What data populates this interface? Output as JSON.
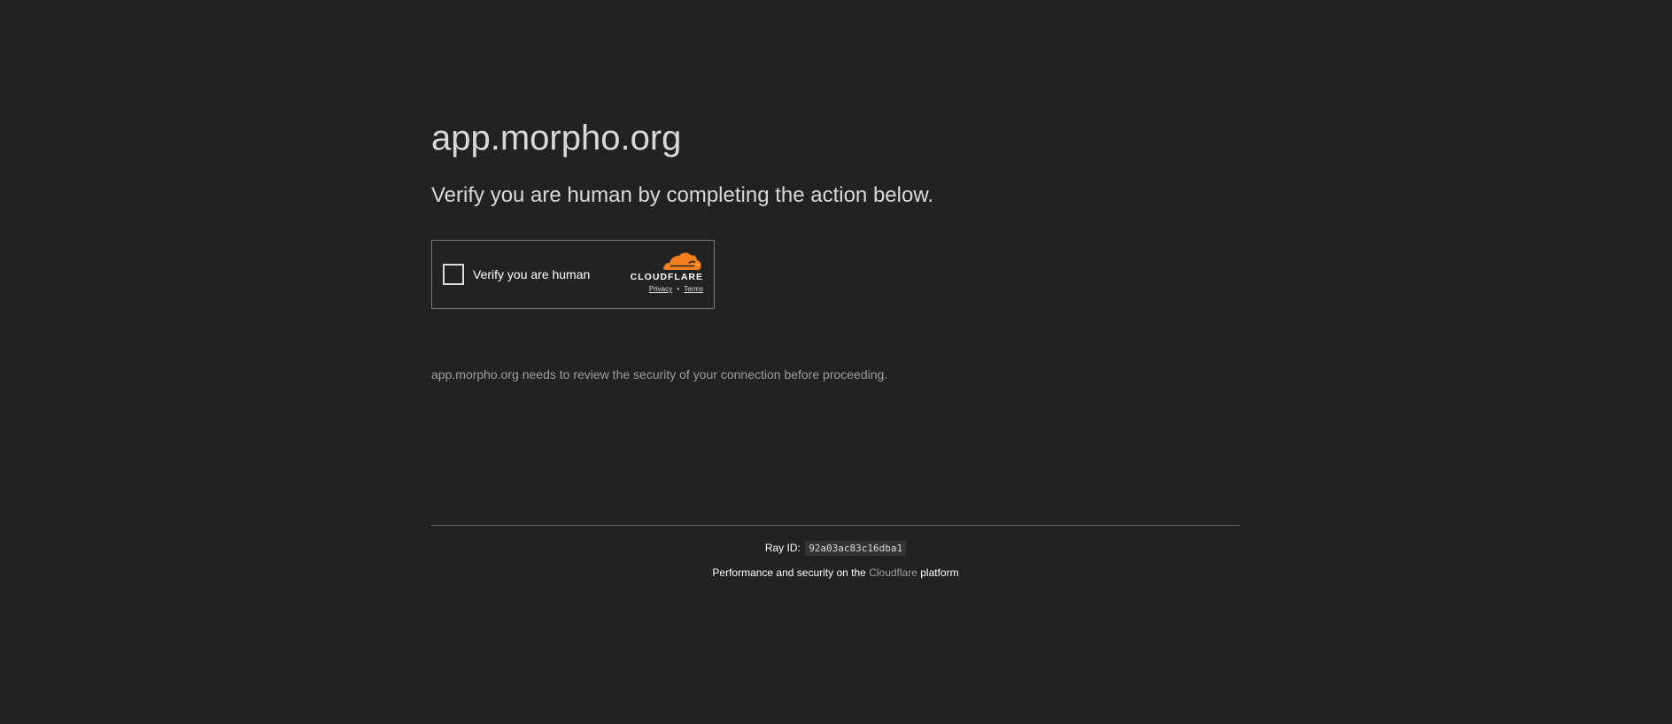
{
  "site": {
    "domain_title": "app.morpho.org",
    "subtitle": "Verify you are human by completing the action below."
  },
  "challenge": {
    "checkbox_label": "Verify you are human",
    "checked": false,
    "brand_name": "CLOUDFLARE",
    "privacy_label": "Privacy",
    "separator": "•",
    "terms_label": "Terms",
    "brand_icon": "cloudflare-cloud-icon",
    "brand_color": "#f38020"
  },
  "notice": "app.morpho.org needs to review the security of your connection before proceeding.",
  "footer": {
    "ray_label": "Ray ID:",
    "ray_id": "92a03ac83c16dba1",
    "perf_prefix": "Performance and security on the",
    "perf_link": "Cloudflare",
    "perf_suffix": "platform"
  },
  "colors": {
    "background": "#222222",
    "text": "#d9d9d9",
    "muted": "#9e9e9e"
  }
}
